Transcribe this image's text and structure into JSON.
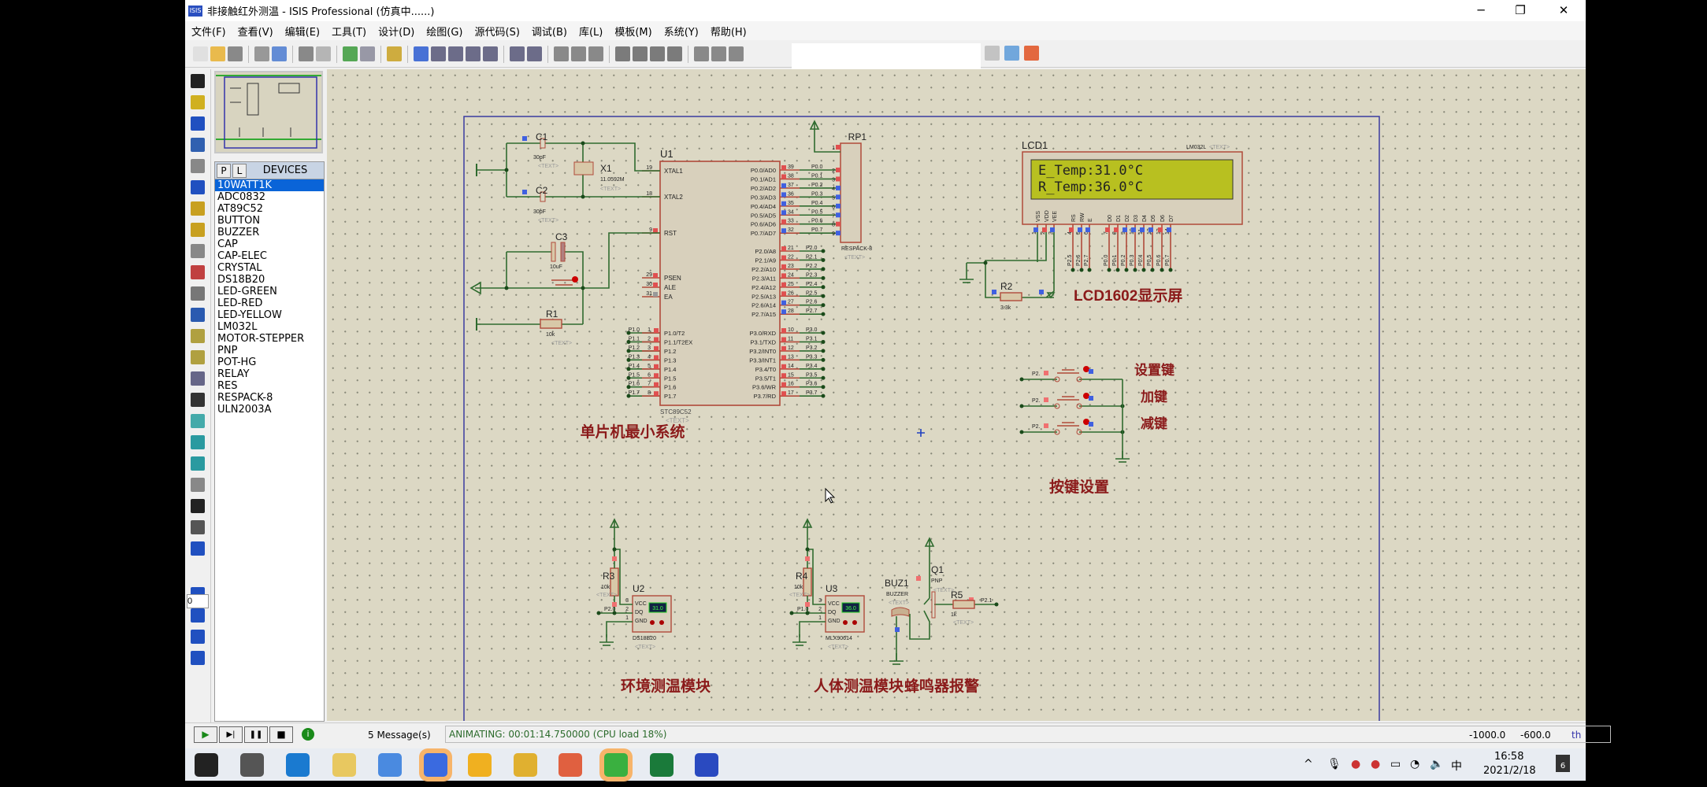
{
  "window": {
    "title": "非接触红外测温 - ISIS Professional (仿真中......)",
    "logo": "ISIS",
    "minimize": "─",
    "maximize": "❐",
    "close": "✕"
  },
  "menu": [
    "文件(F)",
    "查看(V)",
    "编辑(E)",
    "工具(T)",
    "设计(D)",
    "绘图(G)",
    "源代码(S)",
    "调试(B)",
    "库(L)",
    "模板(M)",
    "系统(Y)",
    "帮助(H)"
  ],
  "toolbar_icons": [
    "new-icon",
    "open-icon",
    "save-icon",
    "sep",
    "import-icon",
    "export-icon",
    "sep",
    "print-icon",
    "print-area-icon",
    "sep",
    "refresh-icon",
    "grid-icon",
    "sep",
    "origin-icon",
    "sep",
    "pan-icon",
    "zoom-in-icon",
    "zoom-out-icon",
    "zoom-all-icon",
    "zoom-area-icon",
    "sep",
    "undo-icon",
    "redo-icon",
    "sep",
    "cut-icon",
    "copy-icon",
    "paste-icon",
    "sep",
    "block-copy-icon",
    "block-move-icon",
    "block-rotate-icon",
    "block-delete-icon",
    "sep",
    "pick-device-icon",
    "make-device-icon",
    "package-icon"
  ],
  "toolbar_right_icons": [
    "netlist-icon",
    "bom-icon",
    "ares-icon"
  ],
  "left_tools": [
    "select-icon",
    "component-icon",
    "junction-icon",
    "wire-label-icon",
    "text-script-icon",
    "bus-icon",
    "subcircuit-icon",
    "terminal-icon",
    "device-pin-icon",
    "graph-icon",
    "tape-recorder-icon",
    "generator-icon",
    "voltage-probe-icon",
    "current-probe-icon",
    "virtual-instrument-icon",
    "line-icon",
    "box-icon",
    "circle-icon",
    "arc-icon",
    "path-icon",
    "text-icon",
    "symbol-icon",
    "marker-icon",
    "rotate-cw-icon",
    "rotate-ccw-icon",
    "flip-h-icon",
    "flip-v-icon"
  ],
  "rotation_value": "0",
  "devices": {
    "p": "P",
    "l": "L",
    "header": "DEVICES",
    "selected": 0,
    "items": [
      "10WATT1K",
      "ADC0832",
      "AT89C52",
      "BUTTON",
      "BUZZER",
      "CAP",
      "CAP-ELEC",
      "CRYSTAL",
      "DS18B20",
      "LED-GREEN",
      "LED-RED",
      "LED-YELLOW",
      "LM032L",
      "MOTOR-STEPPER",
      "PNP",
      "POT-HG",
      "RELAY",
      "RES",
      "RESPACK-8",
      "ULN2003A"
    ]
  },
  "schematic": {
    "u1": {
      "ref": "U1",
      "part": "STC89C52",
      "text": "<TEXT>",
      "left_pins": [
        [
          "19",
          "XTAL1"
        ],
        [
          "18",
          "XTAL2"
        ],
        [
          "9",
          "RST"
        ],
        [
          "29",
          "PSEN"
        ],
        [
          "30",
          "ALE"
        ],
        [
          "31",
          "EA"
        ]
      ],
      "p1_pins": [
        [
          "1",
          "P1.0/T2",
          "P1.0"
        ],
        [
          "2",
          "P1.1/T2EX",
          "P1.1"
        ],
        [
          "3",
          "P1.2",
          "P1.2"
        ],
        [
          "4",
          "P1.3",
          "P1.3"
        ],
        [
          "5",
          "P1.4",
          "P1.4"
        ],
        [
          "6",
          "P1.5",
          "P1.5"
        ],
        [
          "7",
          "P1.6",
          "P1.6"
        ],
        [
          "8",
          "P1.7",
          "P1.7"
        ]
      ],
      "p0_pins": [
        [
          "39",
          "P0.0/AD0",
          "P0.0"
        ],
        [
          "38",
          "P0.1/AD1",
          "P0.1"
        ],
        [
          "37",
          "P0.2/AD2",
          "P0.2"
        ],
        [
          "36",
          "P0.3/AD3",
          "P0.3"
        ],
        [
          "35",
          "P0.4/AD4",
          "P0.4"
        ],
        [
          "34",
          "P0.5/AD5",
          "P0.5"
        ],
        [
          "33",
          "P0.6/AD6",
          "P0.6"
        ],
        [
          "32",
          "P0.7/AD7",
          "P0.7"
        ]
      ],
      "p2_pins": [
        [
          "21",
          "P2.0/A8",
          "P2.0"
        ],
        [
          "22",
          "P2.1/A9",
          "P2.1"
        ],
        [
          "23",
          "P2.2/A10",
          "P2.2"
        ],
        [
          "24",
          "P2.3/A11",
          "P2.3"
        ],
        [
          "25",
          "P2.4/A12",
          "P2.4"
        ],
        [
          "26",
          "P2.5/A13",
          "P2.5"
        ],
        [
          "27",
          "P2.6/A14",
          "P2.6"
        ],
        [
          "28",
          "P2.7/A15",
          "P2.7"
        ]
      ],
      "p3_pins": [
        [
          "10",
          "P3.0/RXD",
          "P3.0"
        ],
        [
          "11",
          "P3.1/TXD",
          "P3.1"
        ],
        [
          "12",
          "P3.2/INT0",
          "P3.2"
        ],
        [
          "13",
          "P3.3/INT1",
          "P3.3"
        ],
        [
          "14",
          "P3.4/T0",
          "P3.4"
        ],
        [
          "15",
          "P3.5/T1",
          "P3.5"
        ],
        [
          "16",
          "P3.6/WR",
          "P3.6"
        ],
        [
          "17",
          "P3.7/RD",
          "P3.7"
        ]
      ]
    },
    "rp1": {
      "ref": "RP1",
      "part": "RESPACK-8",
      "text": "<TEXT>",
      "pins": [
        "1",
        "2",
        "3",
        "4",
        "5",
        "6",
        "7",
        "8",
        "9"
      ]
    },
    "c1": {
      "ref": "C1",
      "value": "30pF",
      "text": "<TEXT>"
    },
    "c2": {
      "ref": "C2",
      "value": "30pF",
      "text": "<TEXT>"
    },
    "x1": {
      "ref": "X1",
      "value": "11.0592M",
      "text": "<TEXT>"
    },
    "c3": {
      "ref": "C3",
      "value": "10uF",
      "text": "<TEXT>"
    },
    "r1": {
      "ref": "R1",
      "value": "10k",
      "text": "<TEXT>"
    },
    "lcd": {
      "ref": "LCD1",
      "part": "LM032L",
      "text": "<TEXT>",
      "line1": "E_Temp:31.0°C",
      "line2": "R_Temp:36.0°C",
      "pins": [
        [
          "1",
          "VSS",
          ""
        ],
        [
          "2",
          "VDD",
          ""
        ],
        [
          "3",
          "VEE",
          ""
        ],
        [
          "4",
          "RS",
          "P2.5"
        ],
        [
          "5",
          "RW",
          "P2.6"
        ],
        [
          "6",
          "E",
          "P2.7"
        ],
        [
          "7",
          "D0",
          "P0.0"
        ],
        [
          "8",
          "D1",
          "P0.1"
        ],
        [
          "9",
          "D2",
          "P0.2"
        ],
        [
          "10",
          "D3",
          "P0.3"
        ],
        [
          "11",
          "D4",
          "P0.4"
        ],
        [
          "12",
          "D5",
          "P0.5"
        ],
        [
          "13",
          "D6",
          "P0.6"
        ],
        [
          "14",
          "D7",
          "P0.7"
        ]
      ]
    },
    "r2": {
      "ref": "R2",
      "value": "3.3k"
    },
    "lcd_label": "LCD1602显示屏",
    "mcu_label": "单片机最小系统",
    "keys": {
      "net": "P2.",
      "k1": "设置键",
      "k2": "加键",
      "k3": "减键",
      "label": "按键设置"
    },
    "u2": {
      "ref": "U2",
      "part": "DS18B20",
      "text": "<TEXT>",
      "display": "31.0",
      "r_ref": "R3",
      "r_value": "10k",
      "r_text": "<TEXT>",
      "net": "P2.0",
      "pins": [
        "3",
        "2",
        "1"
      ],
      "pin_names": [
        "VCC",
        "DQ",
        "GND"
      ],
      "label": "环境测温模块"
    },
    "u3": {
      "ref": "U3",
      "part": "MLX90614",
      "text": "<TEXT>",
      "display": "36.0",
      "r_ref": "R4",
      "r_value": "10k",
      "r_text": "<TEXT>",
      "net": "P1.0",
      "pins": [
        "3",
        "2",
        "1"
      ],
      "pin_names": [
        "VCC",
        "DQ",
        "GND"
      ],
      "label": "人体测温模块"
    },
    "buzzer": {
      "ref": "BUZ1",
      "part": "BUZZER",
      "text": "<TEXT>",
      "q_ref": "Q1",
      "q_part": "PNP",
      "q_text": "<TEXT>",
      "r_ref": "R5",
      "r_value": "1k",
      "r_text": "<TEXT>",
      "net": "P2.1",
      "label": "蜂鸣器报警"
    }
  },
  "status": {
    "play": "▶",
    "step": "▶|",
    "pause": "❚❚",
    "stop": "■",
    "messages": "5 Message(s)",
    "animating": "ANIMATING: 00:01:14.750000 (CPU load 18%)",
    "coord_x": "-1000.0",
    "coord_y": "-600.0",
    "unit": "th"
  },
  "colors": {
    "wire": "#2f6b2f",
    "component": "#b04a3a",
    "label": "#8b1a1a",
    "canvas": "#dcd8c4",
    "lcd": "#b8c020",
    "selected": "#0a64d8"
  },
  "taskbar": {
    "apps": [
      "start-icon",
      "search-icon",
      "edge-icon",
      "app-star-icon",
      "baidu-netdisk-icon",
      "app-q-icon",
      "app-hex-icon",
      "file-explorer-icon",
      "app-office-icon",
      "wechat-icon",
      "visio-icon",
      "isis-icon"
    ],
    "time": "16:58",
    "date": "2021/2/18",
    "ime": "中",
    "notifications": "6"
  }
}
